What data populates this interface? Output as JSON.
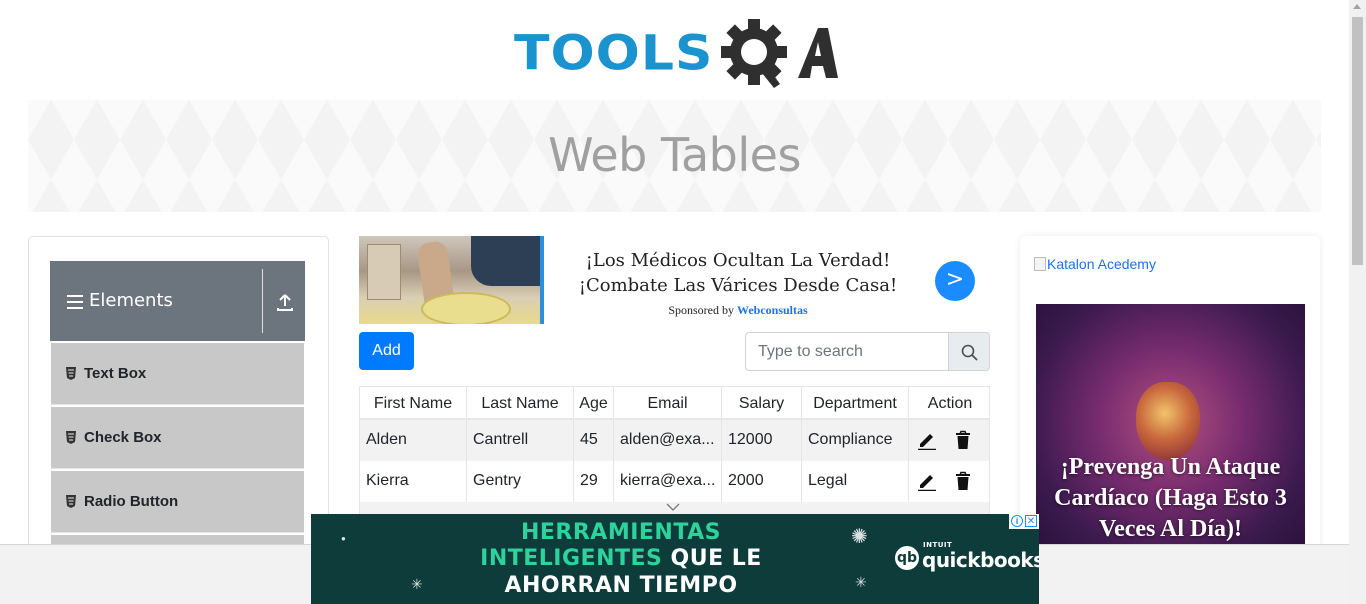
{
  "logo": {
    "text": "TOOLS",
    "suffix": "QA"
  },
  "banner": {
    "title": "Web Tables"
  },
  "sidebar": {
    "group_title": "Elements",
    "items": [
      {
        "label": "Text Box"
      },
      {
        "label": "Check Box"
      },
      {
        "label": "Radio Button"
      }
    ]
  },
  "ad_top": {
    "headline": "¡Los Médicos Ocultan La Verdad! ¡Combate Las Várices Desde Casa!",
    "sponsor_prefix": "Sponsored by ",
    "sponsor_brand": "Webconsultas",
    "go_label": ">"
  },
  "toolbar": {
    "add_label": "Add",
    "search_placeholder": "Type to search"
  },
  "table": {
    "headers": [
      "First Name",
      "Last Name",
      "Age",
      "Email",
      "Salary",
      "Department",
      "Action"
    ],
    "rows": [
      {
        "first": "Alden",
        "last": "Cantrell",
        "age": "45",
        "email": "alden@exa...",
        "salary": "12000",
        "department": "Compliance"
      },
      {
        "first": "Kierra",
        "last": "Gentry",
        "age": "29",
        "email": "kierra@exa...",
        "salary": "2000",
        "department": "Legal"
      }
    ]
  },
  "right_ad": {
    "link_text": "Katalon Acedemy",
    "caption": "¡Prevenga Un Ataque Cardíaco (Haga Esto 3 Veces Al Día)!"
  },
  "bottom_ad": {
    "line1": "HERRAMIENTAS",
    "line2_green": "INTELIGENTES",
    "line2_white": " QUE LE",
    "line3": "AHORRAN TIEMPO",
    "brand_small": "INTUIT",
    "brand": "quickbooks",
    "brand_mark": "qb"
  },
  "colors": {
    "logo_blue": "#1a93cf",
    "primary": "#007bff",
    "sidebar_header": "#6c757d",
    "sidebar_item": "#c8c8c8",
    "bottom_ad_bg": "#0e3c3b",
    "bottom_ad_accent": "#2ed39b"
  }
}
